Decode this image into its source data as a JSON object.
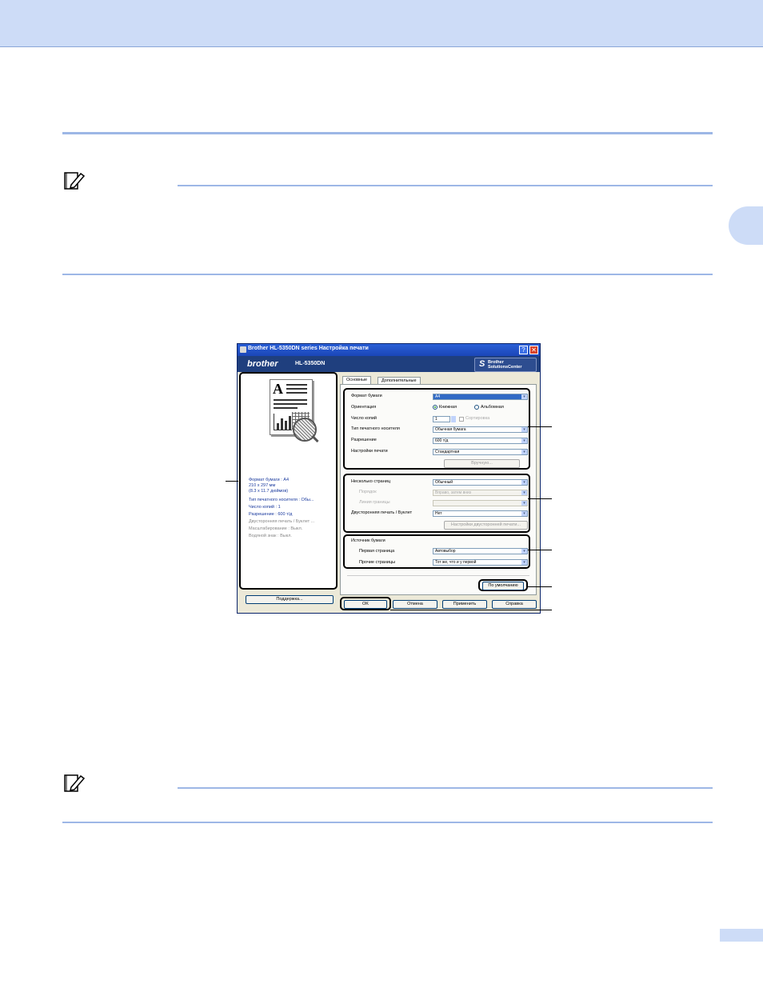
{
  "dialog": {
    "title": "Brother HL-5350DN series Настройка печати",
    "help_label": "?",
    "close_label": "✕",
    "brand_logo": "brother",
    "model": "HL-5350DN",
    "solutions_center": {
      "line1": "Brother",
      "line2": "SolutionsCenter"
    },
    "preview_lines": [
      "Формат бумаги : A4",
      "210 x 297 мм",
      "(8.3 x 11.7 дюймов)",
      "Тип печатного носителя : Обы...",
      "Число копий : 1",
      "Разрешение : 600 т/д",
      "Двусторонняя печать / Буклет ...",
      "Масштабирование : Выкл.",
      "Водяной знак : Выкл."
    ],
    "support_button": "Поддержка...",
    "tabs": [
      "Основные",
      "Дополнительные"
    ],
    "fields": {
      "paper_size_label": "Формат бумаги",
      "paper_size_value": "A4",
      "orientation_label": "Ориентация",
      "orientation_portrait": "Книжная",
      "orientation_landscape": "Альбомная",
      "copies_label": "Число копий",
      "copies_value": "1",
      "collate_label": "Сортировка",
      "media_type_label": "Тип печатного носителя",
      "media_type_value": "Обычная бумага",
      "resolution_label": "Разрешение",
      "resolution_value": "600 т/д",
      "print_settings_label": "Настройки печати",
      "print_settings_value": "Стандартная",
      "manual_button": "Вручную...",
      "multiple_page_label": "Несколько страниц",
      "multiple_page_value": "Обычный",
      "page_order_label": "Порядок",
      "page_order_value": "Вправо, затем вниз",
      "border_line_label": "Линия границы",
      "border_line_value": "",
      "duplex_label": "Двусторонняя печать / Буклет",
      "duplex_value": "Нет",
      "duplex_settings_button": "Настройки двусторонней печати...",
      "paper_source_label": "Источник бумаги",
      "first_page_label": "Первая страница",
      "first_page_value": "Автовыбор",
      "other_pages_label": "Прочие страницы",
      "other_pages_value": "Тот же, что и у первой"
    },
    "default_button": "По умолчанию",
    "buttons": {
      "ok": "OK",
      "cancel": "Отмена",
      "apply": "Применить",
      "help": "Справка"
    }
  }
}
